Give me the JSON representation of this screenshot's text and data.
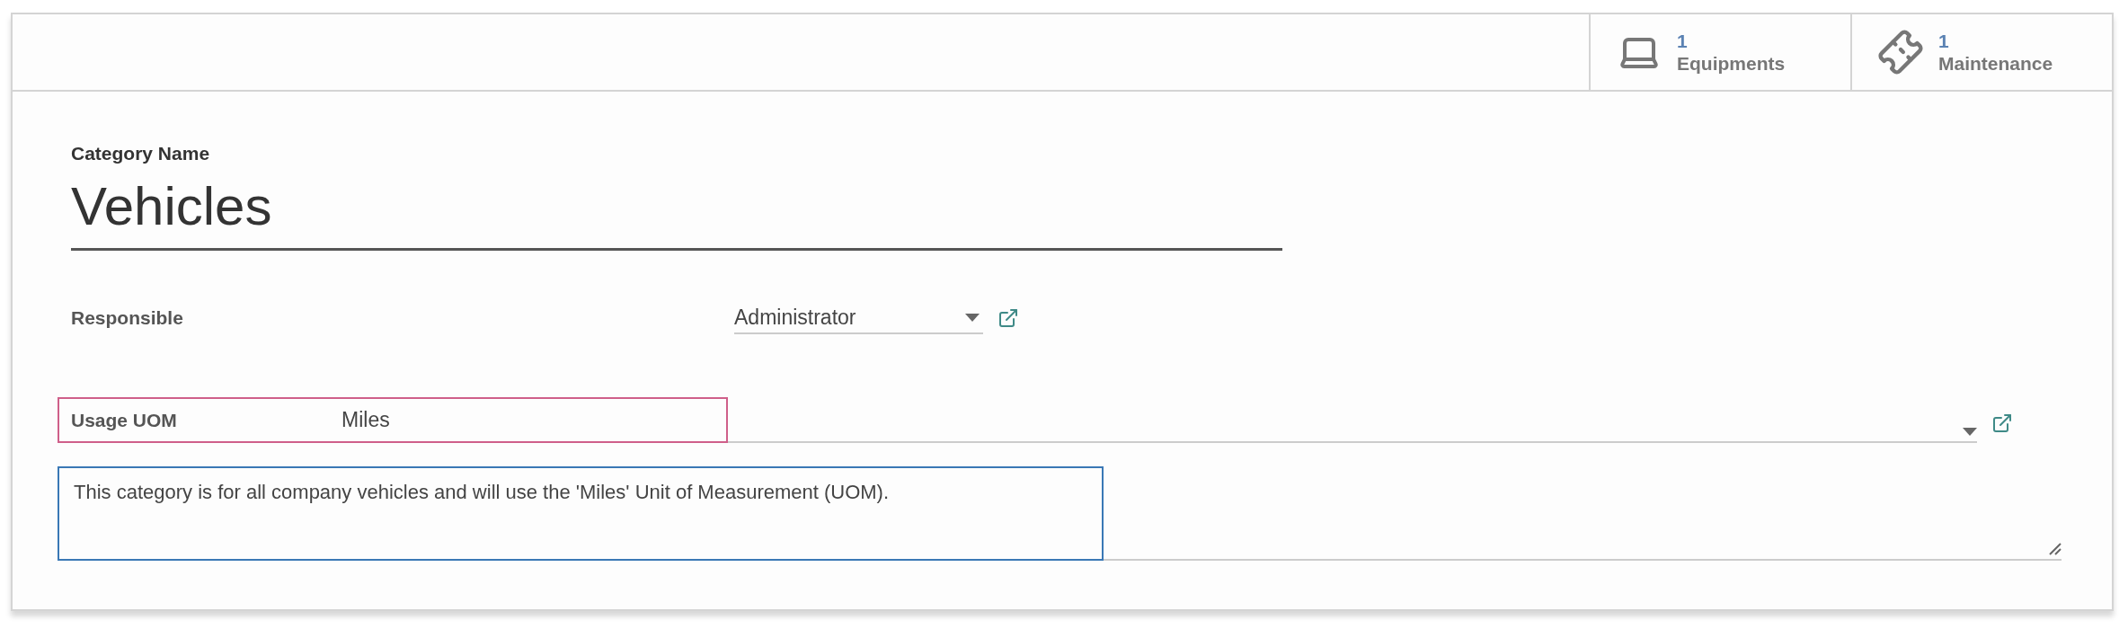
{
  "stat_buttons": [
    {
      "kind": "laptop",
      "count": "1",
      "label": "Equipments"
    },
    {
      "kind": "ticket",
      "count": "1",
      "label": "Maintenance"
    }
  ],
  "category_name": {
    "label": "Category Name",
    "value": "Vehicles"
  },
  "responsible": {
    "label": "Responsible",
    "value": "Administrator"
  },
  "usage_uom": {
    "label": "Usage UOM",
    "value": "Miles",
    "color": "#cf5f8a"
  },
  "description": {
    "text": "This category is for all company vehicles and will use the 'Miles' Unit of Measurement (UOM).",
    "color": "#3a78b5"
  }
}
